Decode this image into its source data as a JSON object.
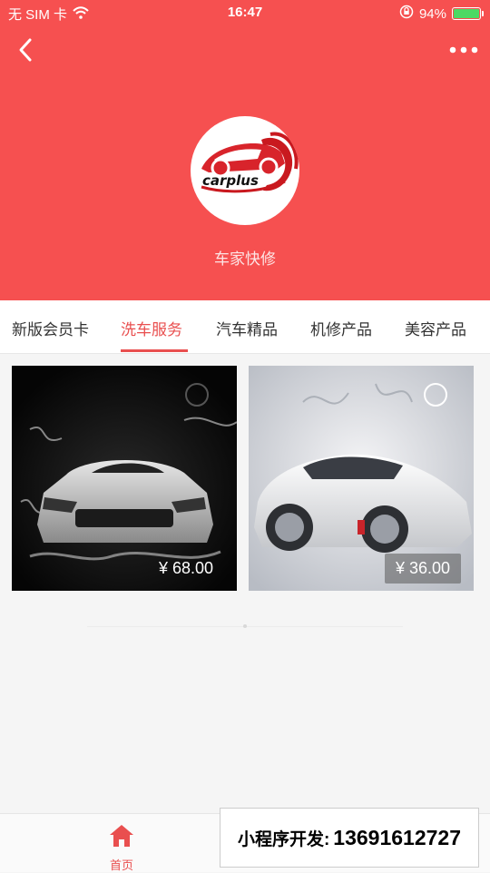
{
  "status_bar": {
    "carrier": "无 SIM 卡",
    "time": "16:47",
    "battery": "94%",
    "battery_level": 0.94
  },
  "header": {
    "shop_name": "车家快修",
    "logo_text": "carplus",
    "background_color": "#f65050"
  },
  "tabs": [
    {
      "label": "新版会员卡",
      "active": false
    },
    {
      "label": "洗车服务",
      "active": true
    },
    {
      "label": "汽车精品",
      "active": false
    },
    {
      "label": "机修产品",
      "active": false
    },
    {
      "label": "美容产品",
      "active": false
    }
  ],
  "products": [
    {
      "price": "¥ 68.00",
      "image": "dark-sports-car-water-splash"
    },
    {
      "price": "¥ 36.00",
      "image": "white-sports-car-water-splash"
    }
  ],
  "bottom_nav": {
    "home_label": "首页",
    "accent_color": "#e94f4f"
  },
  "overlay": {
    "label": "小程序开发:",
    "phone": "13691612727"
  }
}
